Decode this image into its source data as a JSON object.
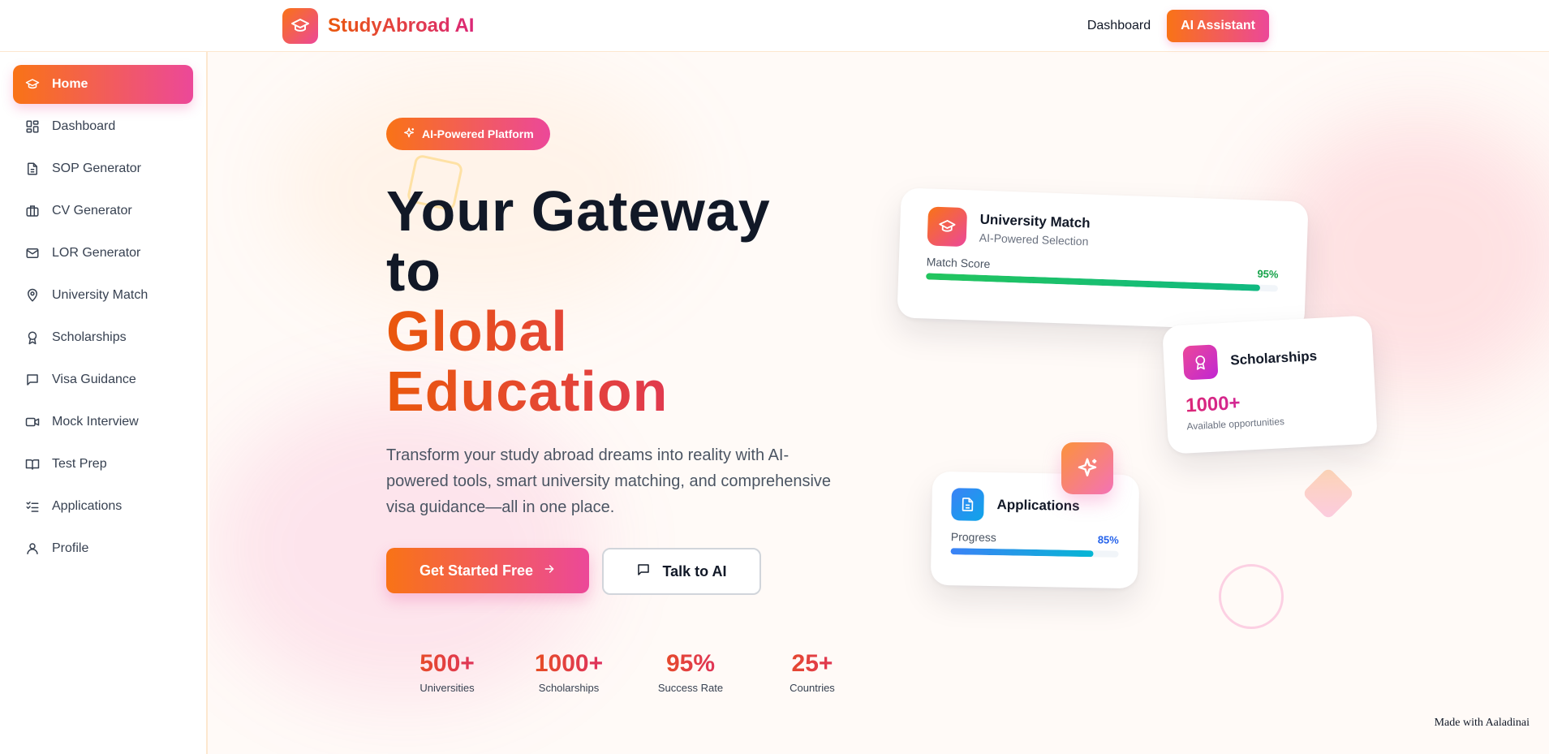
{
  "header": {
    "brand_name": "StudyAbroad AI",
    "nav_dashboard": "Dashboard",
    "nav_cta": "AI Assistant"
  },
  "sidebar": {
    "items": [
      {
        "label": "Home",
        "icon": "graduation-cap-icon",
        "active": true
      },
      {
        "label": "Dashboard",
        "icon": "dashboard-grid-icon"
      },
      {
        "label": "SOP Generator",
        "icon": "document-icon"
      },
      {
        "label": "CV Generator",
        "icon": "briefcase-icon"
      },
      {
        "label": "LOR Generator",
        "icon": "mail-icon"
      },
      {
        "label": "University Match",
        "icon": "map-pin-icon"
      },
      {
        "label": "Scholarships",
        "icon": "award-icon"
      },
      {
        "label": "Visa Guidance",
        "icon": "message-icon"
      },
      {
        "label": "Mock Interview",
        "icon": "video-icon"
      },
      {
        "label": "Test Prep",
        "icon": "book-icon"
      },
      {
        "label": "Applications",
        "icon": "checklist-icon"
      },
      {
        "label": "Profile",
        "icon": "user-icon"
      }
    ]
  },
  "hero": {
    "badge": "AI-Powered Platform",
    "title_line1": "Your Gateway",
    "title_line2": "to",
    "title_line3": "Global",
    "title_line4": "Education",
    "description": "Transform your study abroad dreams into reality with AI-powered tools, smart university matching, and comprehensive visa guidance—all in one place.",
    "primary_button": "Get Started Free",
    "secondary_button": "Talk to AI"
  },
  "stats": [
    {
      "value": "500+",
      "label": "Universities"
    },
    {
      "value": "1000+",
      "label": "Scholarships"
    },
    {
      "value": "95%",
      "label": "Success Rate"
    },
    {
      "value": "25+",
      "label": "Countries"
    }
  ],
  "cards": {
    "match": {
      "title": "University Match",
      "subtitle": "AI-Powered Selection",
      "metric_label": "Match Score",
      "metric_value": "95%",
      "progress": 0.95
    },
    "scholarships": {
      "title": "Scholarships",
      "value": "1000+",
      "subtitle": "Available opportunities"
    },
    "applications": {
      "title": "Applications",
      "metric_label": "Progress",
      "metric_value": "85%",
      "progress": 0.85
    }
  },
  "footer": {
    "watermark": "Made with Aaladinai"
  },
  "colors": {
    "accent_start": "#f97316",
    "accent_end": "#ec4899",
    "success": "#16a34a",
    "info": "#2563eb"
  }
}
